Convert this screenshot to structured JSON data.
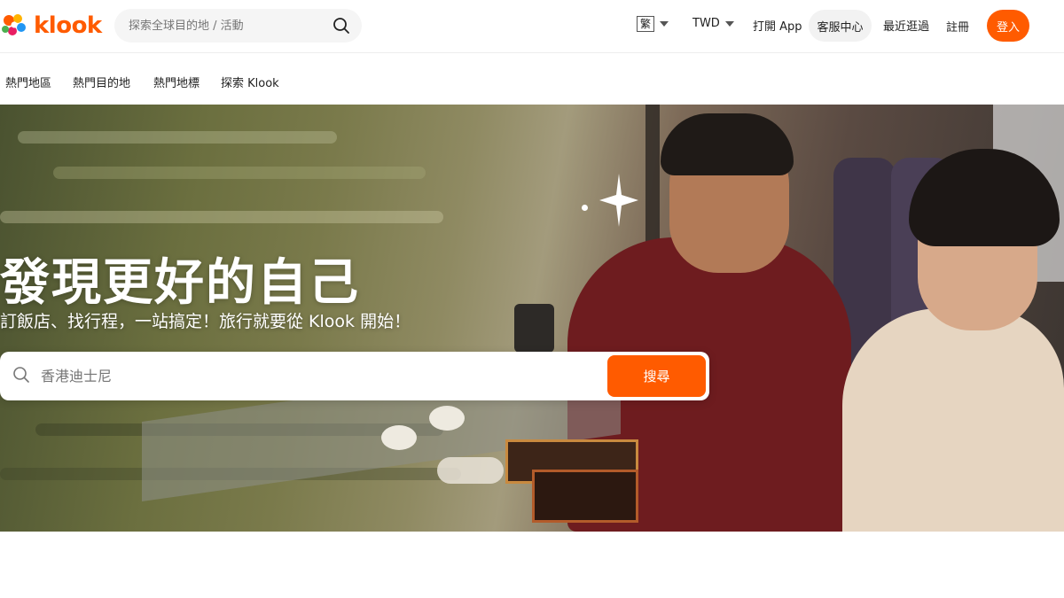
{
  "header": {
    "logo_text": "klook",
    "search_placeholder": "探索全球目的地 / 活動",
    "language": "繁",
    "currency": "TWD",
    "open_app": "打開 App",
    "help_center": "客服中心",
    "recent": "最近逛過",
    "signup": "註冊",
    "login": "登入"
  },
  "subnav": {
    "items": [
      {
        "label": "熱門地區"
      },
      {
        "label": "熱門目的地"
      },
      {
        "label": "熱門地標"
      },
      {
        "label": "探索 Klook"
      }
    ]
  },
  "hero": {
    "title": "發現更好的自己",
    "subtitle": "訂飯店、找行程，一站搞定！旅行就要從 Klook 開始！",
    "search_placeholder": "香港迪士尼",
    "search_button": "搜尋"
  },
  "colors": {
    "brand": "#ff5b00",
    "text": "#212121",
    "muted": "#757575"
  },
  "icons": {
    "logo": "klook-logo-icon",
    "search": "search-icon",
    "caret": "chevron-down-icon",
    "sparkle": "sparkle-icon"
  }
}
